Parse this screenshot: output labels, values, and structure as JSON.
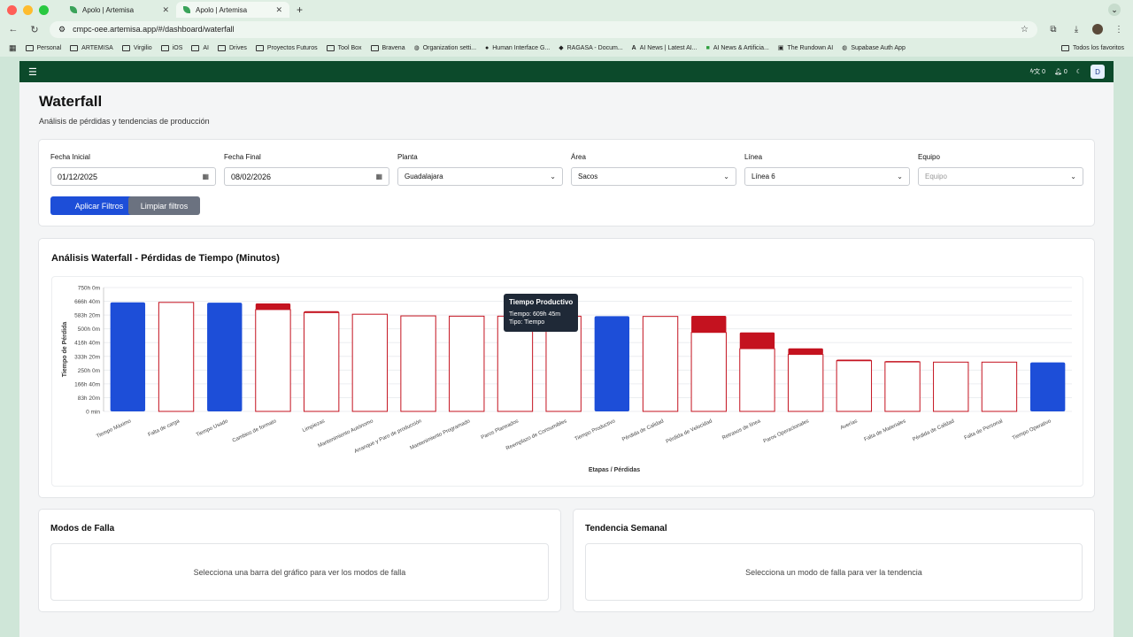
{
  "browser": {
    "tabs": [
      {
        "title": "Apolo | Artemisa"
      },
      {
        "title": "Apolo | Artemisa"
      }
    ],
    "url": "cmpc-oee.artemisa.app/#/dashboard/waterfall",
    "bookmarks": [
      "Personal",
      "ARTEMISA",
      "Virgilio",
      "iOS",
      "AI",
      "Drives",
      "Proyectos Futuros",
      "Tool Box",
      "Bravena",
      "Organization setti...",
      "Human Interface G...",
      "RAGASA - Docum...",
      "AI News | Latest AI...",
      "AI News & Artificia...",
      "The Rundown AI",
      "Supabase Auth App"
    ],
    "bookmarks_right": "Todos los favoritos"
  },
  "topbar": {
    "badge1": "0",
    "badge2": "0",
    "user": "D"
  },
  "page": {
    "title": "Waterfall",
    "subtitle": "Análisis de pérdidas y tendencias de producción"
  },
  "filters": {
    "fecha_inicial": {
      "label": "Fecha Inicial",
      "value": "01/12/2025"
    },
    "fecha_final": {
      "label": "Fecha Final",
      "value": "08/02/2026"
    },
    "planta": {
      "label": "Planta",
      "value": "Guadalajara"
    },
    "area": {
      "label": "Área",
      "value": "Sacos"
    },
    "linea": {
      "label": "Línea",
      "value": "Línea 6"
    },
    "equipo": {
      "label": "Equipo",
      "placeholder": "Equipo"
    },
    "apply_label": "Aplicar Filtros",
    "clear_label": "Limpiar filtros"
  },
  "chart_card": {
    "title": "Análisis Waterfall - Pérdidas de Tiempo (Minutos)"
  },
  "chart_data": {
    "type": "bar",
    "xlabel": "Etapas / Pérdidas",
    "ylabel": "Tiempo de Pérdida",
    "ylim": [
      0,
      45000
    ],
    "yticks": [
      "0 min",
      "83h 20m",
      "166h 40m",
      "250h 0m",
      "333h 20m",
      "416h 40m",
      "500h 0m",
      "583h 20m",
      "666h 40m",
      "750h 0m"
    ],
    "categories": [
      "Tiempo Máximo",
      "Falta de carga",
      "Tiempo Usado",
      "Cambios de formato",
      "Limpiezas",
      "Mantenimiento Autónomo",
      "Arranque y Paro de producción",
      "Mantenimiento Programado",
      "Paros Planeados",
      "Reemplazo de Consumibles",
      "Tiempo Productivo",
      "Pérdida de Calidad",
      "Pérdida de Velocidad",
      "Retrasos de línea",
      "Paros Operacionales",
      "Averías",
      "Falta de Materiales",
      "Pérdida de Calidad",
      "Falta de Personal",
      "Tiempo Operativo"
    ],
    "base": [
      0,
      0,
      0,
      37000,
      35900,
      35100,
      0,
      0,
      0,
      0,
      0,
      0,
      28700,
      22800,
      20700,
      18400,
      18000,
      0,
      0,
      0
    ],
    "values": [
      39600,
      39600,
      39500,
      2200,
      500,
      200,
      34700,
      34600,
      34600,
      34585,
      34585,
      34500,
      6000,
      5900,
      2200,
      400,
      300,
      17900,
      17900,
      17800
    ],
    "kind": [
      "total",
      "outline",
      "total",
      "loss",
      "loss",
      "outline",
      "outline",
      "outline",
      "outline",
      "outline",
      "total",
      "outline",
      "loss",
      "loss",
      "loss",
      "loss",
      "loss",
      "outline",
      "outline",
      "total"
    ],
    "colors": {
      "total": "#1d4ed8",
      "loss": "#c4121f",
      "outline": "#c4121f"
    },
    "tooltip": {
      "title": "Tiempo Productivo",
      "line1": "Tiempo: 609h 45m",
      "line2": "Tipo: Tiempo"
    }
  },
  "modos_falla": {
    "title": "Modos de Falla",
    "empty": "Selecciona una barra del gráfico para ver los modos de falla"
  },
  "tendencia": {
    "title": "Tendencia Semanal",
    "empty": "Selecciona un modo de falla para ver la tendencia"
  }
}
